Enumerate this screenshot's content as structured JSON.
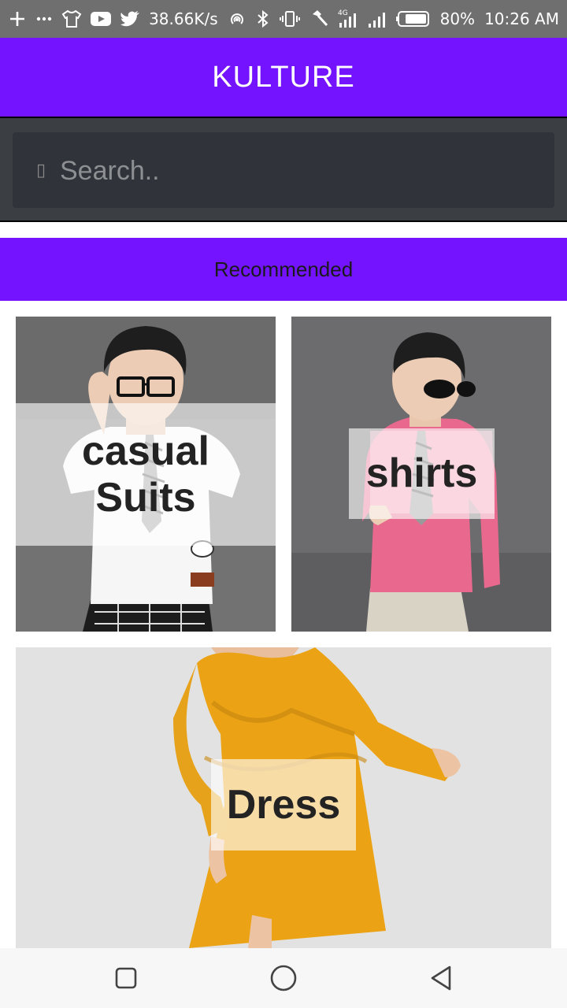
{
  "status_bar": {
    "net_speed": "38.66K/s",
    "battery": "80%",
    "time": "10:26 AM",
    "network_type": "4G",
    "icons_left": [
      "plus-icon",
      "more-icon",
      "tshirt-icon",
      "youtube-icon",
      "twitter-icon"
    ],
    "icons_right": [
      "hotspot-icon",
      "bluetooth-icon",
      "vibrate-icon",
      "hammer-icon",
      "signal-4g-icon",
      "signal-icon",
      "battery-icon"
    ]
  },
  "header": {
    "title": "KULTURE",
    "color": "#7413ff"
  },
  "search": {
    "placeholder": "Search..",
    "value": "",
    "icon_glyph": "▯"
  },
  "recommended": {
    "label": "Recommended"
  },
  "categories": [
    {
      "name": "casual Suits",
      "line1": "casual",
      "line2": "Suits"
    },
    {
      "name": "shirts"
    },
    {
      "name": "Dress"
    }
  ],
  "nav": {
    "buttons": [
      "recent-apps-button",
      "home-button",
      "back-button"
    ]
  }
}
